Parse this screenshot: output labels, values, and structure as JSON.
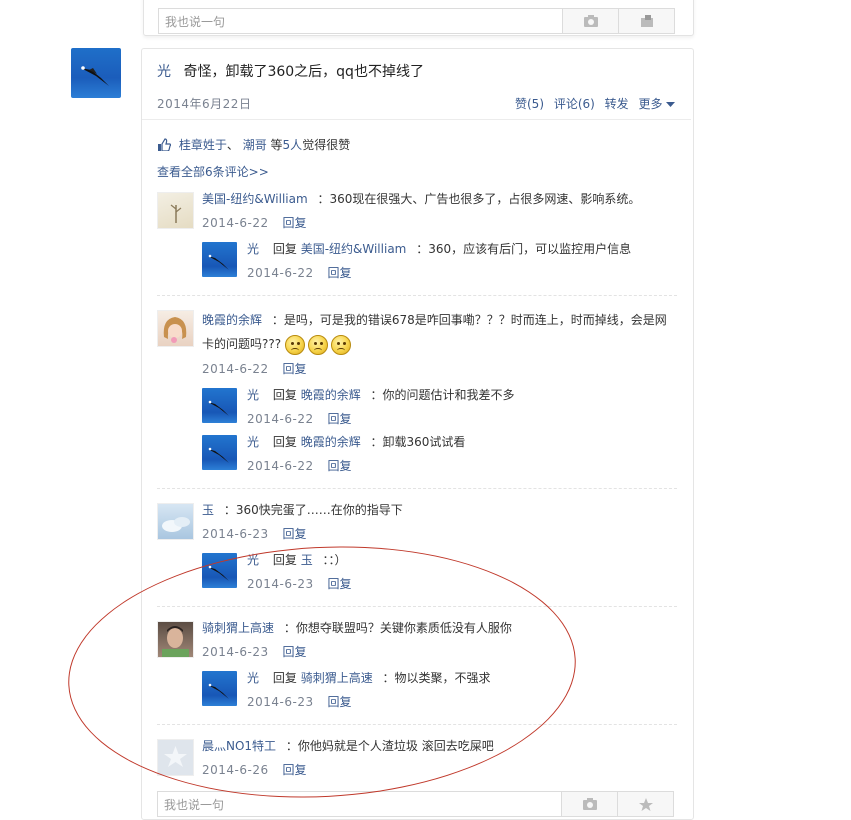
{
  "previous_post": {
    "input_placeholder": "我也说一句"
  },
  "post": {
    "author": "光",
    "content": "奇怪，卸载了360之后，qq也不掉线了",
    "date": "2014年6月22日",
    "actions": {
      "like": "赞(5)",
      "comment": "评论(6)",
      "forward": "转发",
      "more": "更多"
    },
    "likes": {
      "user1": "桂章姓于",
      "sep": "、",
      "user2": "潮哥",
      "prefix": "等",
      "count": "5人",
      "suffix": "觉得很赞"
    },
    "view_all": "查看全部6条评论>>"
  },
  "comments": [
    {
      "user": "美国-纽约&William",
      "text": "：360现在很强大、广告也很多了，占很多网速、影响系统。",
      "date": "2014-6-22",
      "reply_btn": "回复",
      "replies": [
        {
          "user": "光",
          "reply_word": "回复",
          "target": "美国-纽约&William",
          "text": "：360，应该有后门，可以监控用户信息",
          "date": "2014-6-22",
          "reply_btn": "回复"
        }
      ]
    },
    {
      "user": "晚霞的余辉",
      "text_line1": "：是吗，可是我的错误678是咋回事嘞？？？时而连上，时而掉线，会是网",
      "text_line2": "卡的问题吗???",
      "date": "2014-6-22",
      "reply_btn": "回复",
      "replies": [
        {
          "user": "光",
          "reply_word": "回复",
          "target": "晚霞的余辉",
          "text": "：你的问题估计和我差不多",
          "date": "2014-6-22",
          "reply_btn": "回复"
        },
        {
          "user": "光",
          "reply_word": "回复",
          "target": "晚霞的余辉",
          "text": "：卸载360试试看",
          "date": "2014-6-22",
          "reply_btn": "回复"
        }
      ]
    },
    {
      "user": "玉",
      "text": "：360快完蛋了……在你的指导下",
      "date": "2014-6-23",
      "reply_btn": "回复",
      "replies": [
        {
          "user": "光",
          "reply_word": "回复",
          "target": "玉",
          "text": "：：）",
          "date": "2014-6-23",
          "reply_btn": "回复"
        }
      ]
    },
    {
      "user": "骑刺猬上高速",
      "text": "：你想夺联盟吗？关键你素质低没有人服你",
      "date": "2014-6-23",
      "reply_btn": "回复",
      "replies": [
        {
          "user": "光",
          "reply_word": "回复",
          "target": "骑刺猬上高速",
          "text": "：物以类聚，不强求",
          "date": "2014-6-23",
          "reply_btn": "回复"
        }
      ]
    },
    {
      "user": "晨灬NO1特工",
      "text": "：你他妈就是个人渣垃圾 滚回去吃屎吧",
      "date": "2014-6-26",
      "reply_btn": "回复",
      "replies": []
    }
  ],
  "comment_input_placeholder": "我也说一句",
  "colors": {
    "link": "#3b5b8f",
    "annotation_ellipse": "#c0392b"
  }
}
